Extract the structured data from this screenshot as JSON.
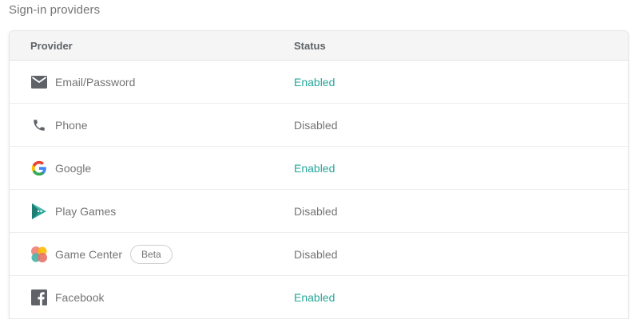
{
  "section_title": "Sign-in providers",
  "table": {
    "columns": {
      "provider": "Provider",
      "status": "Status"
    },
    "rows": [
      {
        "name": "Email/Password",
        "status": "Enabled",
        "icon": "email-icon"
      },
      {
        "name": "Phone",
        "status": "Disabled",
        "icon": "phone-icon"
      },
      {
        "name": "Google",
        "status": "Enabled",
        "icon": "google-icon"
      },
      {
        "name": "Play Games",
        "status": "Disabled",
        "icon": "play-games-icon"
      },
      {
        "name": "Game Center",
        "status": "Disabled",
        "icon": "game-center-icon",
        "badge": "Beta"
      },
      {
        "name": "Facebook",
        "status": "Enabled",
        "icon": "facebook-icon"
      }
    ]
  },
  "colors": {
    "enabled": "#26a69a",
    "disabled": "#757575",
    "header_bg": "#f5f5f5"
  }
}
